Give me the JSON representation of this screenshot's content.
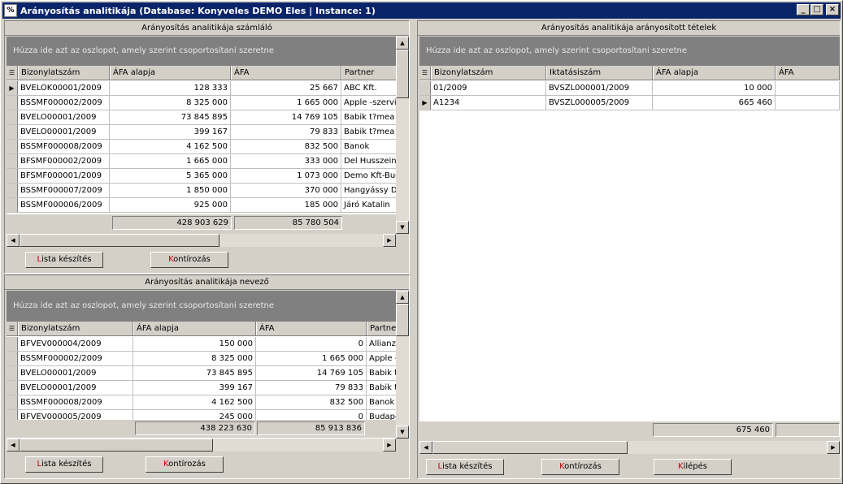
{
  "window": {
    "title": "Arányosítás analitikája  (Database: Konyveles DEMO  Eles | Instance: 1)",
    "controls": {
      "minimize": "_",
      "maximize": "□",
      "close": "×"
    }
  },
  "left_top": {
    "caption": "Arányosítás analitikája számláló",
    "group_hint": "Húzza ide azt az oszlopot, amely szerint csoportosítani szeretne",
    "columns": [
      "Bizonylatszám",
      "ÁFA alapja",
      "ÁFA",
      "Partner"
    ],
    "rows": [
      [
        "BVELOK00001/2009",
        "128 333",
        "25 667",
        "ABC Kft."
      ],
      [
        "BSSMF000002/2009",
        "8 325 000",
        "1 665 000",
        "Apple -szerviz"
      ],
      [
        "BVELO00001/2009",
        "73 845 895",
        "14 769 105",
        "Babik t?mea"
      ],
      [
        "BVELO00001/2009",
        "399 167",
        "79 833",
        "Babik t?mea"
      ],
      [
        "BSSMF000008/2009",
        "4 162 500",
        "832 500",
        "Banok"
      ],
      [
        "BFSMF000002/2009",
        "1 665 000",
        "333 000",
        "Del Husszein"
      ],
      [
        "BFSMF000001/2009",
        "5 365 000",
        "1 073 000",
        "Demo Kft-Buc"
      ],
      [
        "BSSMF000007/2009",
        "1 850 000",
        "370 000",
        "Hangyássy De"
      ],
      [
        "BSSMF000006/2009",
        "925 000",
        "185 000",
        "Járó Katalin"
      ]
    ],
    "sum_base": "428 903 629",
    "sum_vat": "85 780 504",
    "btn_list_acc": "L",
    "btn_list_rest": "ista készítés",
    "btn_post_acc": "K",
    "btn_post_rest": "ontírozás"
  },
  "left_bottom": {
    "caption": "Arányosítás analitikája nevező",
    "group_hint": "Húzza ide azt az oszlopot, amely szerint csoportosítani szeretne",
    "columns": [
      "Bizonylatszám",
      "ÁFA alapja",
      "ÁFA",
      "Partner"
    ],
    "rows": [
      [
        "BFVEV000004/2009",
        "150 000",
        "0",
        "Allianz B"
      ],
      [
        "BSSMF000002/2009",
        "8 325 000",
        "1 665 000",
        "Apple -s"
      ],
      [
        "BVELO00001/2009",
        "73 845 895",
        "14 769 105",
        "Babik t?"
      ],
      [
        "BVELO00001/2009",
        "399 167",
        "79 833",
        "Babik t?"
      ],
      [
        "BSSMF000008/2009",
        "4 162 500",
        "832 500",
        "Banok"
      ],
      [
        "BFVEV000005/2009",
        "245 000",
        "0",
        "Budapes"
      ]
    ],
    "sum_base": "438 223 630",
    "sum_vat": "85 913 836",
    "btn_list_acc": "L",
    "btn_list_rest": "ista készítés",
    "btn_post_acc": "K",
    "btn_post_rest": "ontírozás"
  },
  "right": {
    "caption": "Arányosítás analitikája arányosított tételek",
    "group_hint": "Húzza ide azt az oszlopot, amely szerint csoportosítani szeretne",
    "columns": [
      "Bizonylatszám",
      "Iktatásiszám",
      "ÁFA alapja",
      "ÁFA"
    ],
    "rows": [
      [
        "01/2009",
        "BVSZL000001/2009",
        "10 000",
        ""
      ],
      [
        "A1234",
        "BVSZL000005/2009",
        "665 460",
        ""
      ]
    ],
    "sum_base": "675 460",
    "btn_list_acc": "L",
    "btn_list_rest": "ista készítés",
    "btn_post_acc": "K",
    "btn_post_rest": "ontírozás",
    "btn_exit_acc": "K",
    "btn_exit_rest": "ilépés"
  }
}
